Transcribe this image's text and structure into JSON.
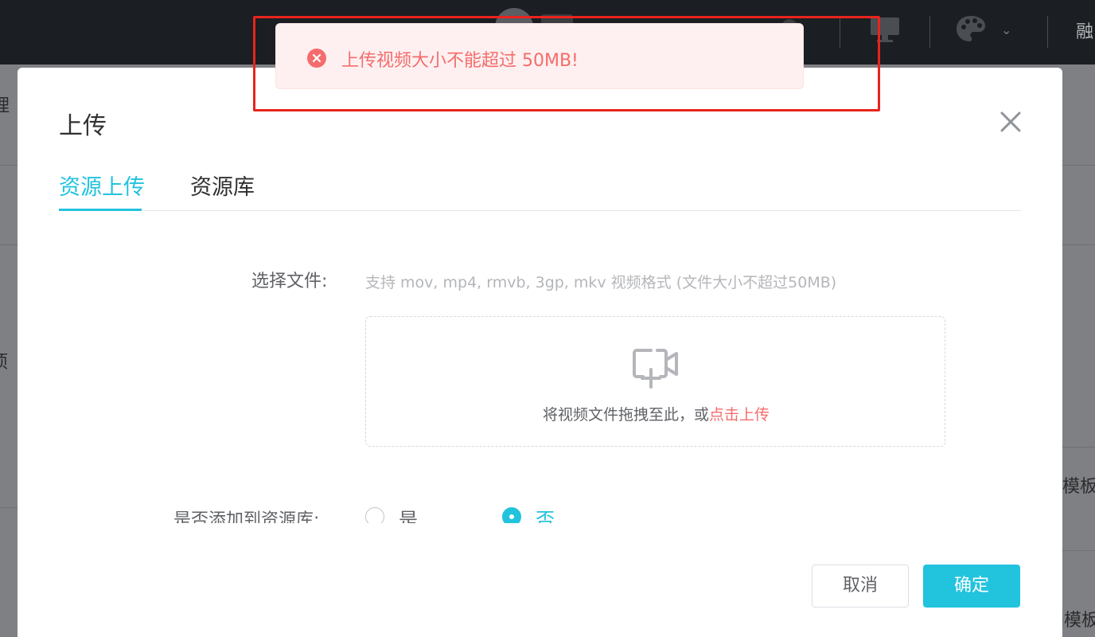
{
  "topbar": {
    "user_name_partial": "融"
  },
  "background": {
    "left_fragments": [
      "理",
      "项"
    ],
    "right_fragments": [
      "模板",
      "档模板"
    ]
  },
  "modal": {
    "title": "上传",
    "tabs": [
      {
        "label": "资源上传",
        "active": true
      },
      {
        "label": "资源库",
        "active": false
      }
    ],
    "file_label": "选择文件:",
    "file_hint": "支持 mov, mp4, rmvb, 3gp, mkv 视频格式 (文件大小不超过50MB)",
    "dropzone": {
      "text": "将视频文件拖拽至此，或",
      "link": "点击上传"
    },
    "add_to_library_label": "是否添加到资源库:",
    "radio_options": [
      {
        "label": "是",
        "checked": false
      },
      {
        "label": "否",
        "checked": true
      }
    ],
    "cancel_label": "取消",
    "ok_label": "确定"
  },
  "toast": {
    "type": "error",
    "message": "上传视频大小不能超过 50MB!"
  },
  "colors": {
    "primary": "#22c3dd",
    "error": "#f56c6c",
    "error_bg": "#fef0f0",
    "highlight": "#e8241c",
    "topbar": "#1b1e22"
  }
}
